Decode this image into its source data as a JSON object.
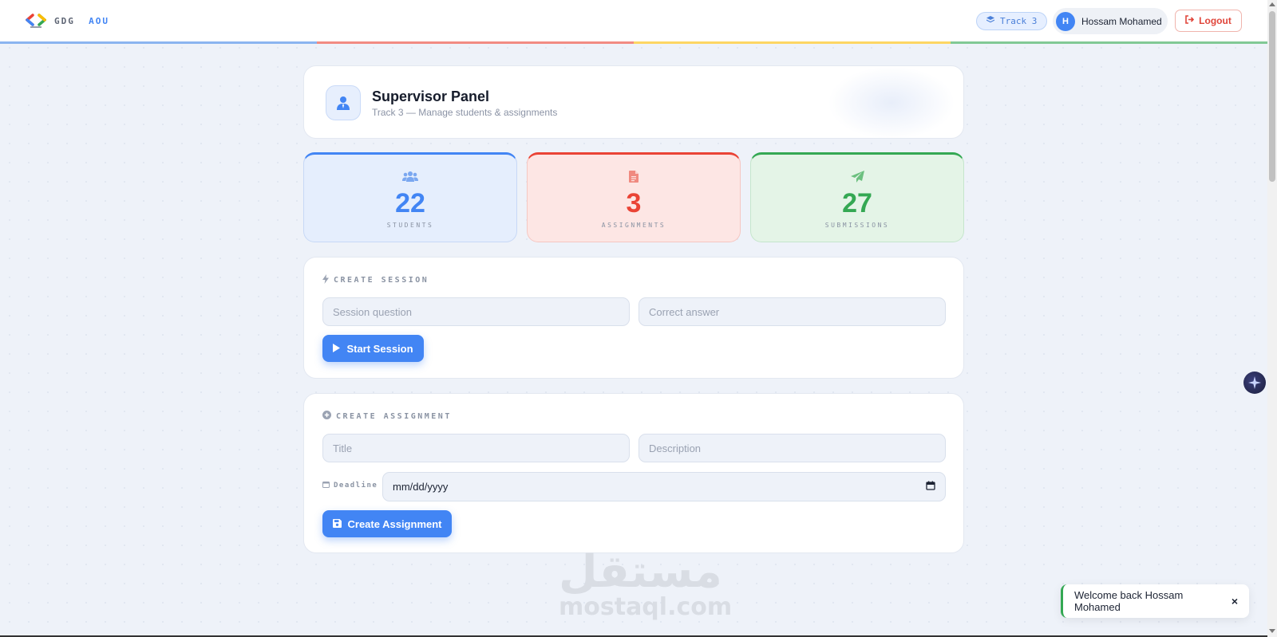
{
  "header": {
    "logo": {
      "word1": "GDG",
      "word2": "AOU"
    },
    "track_pill": "Track 3",
    "user": {
      "initial": "H",
      "name": "Hossam Mohamed"
    },
    "logout_label": "Logout",
    "color_bar": [
      "#8ab4f0",
      "#f28b82",
      "#fdd663",
      "#81c995"
    ]
  },
  "panel": {
    "title": "Supervisor Panel",
    "subtitle": "Track 3 — Manage students & assignments",
    "icon": "user-tie-icon"
  },
  "stats": [
    {
      "value": "22",
      "label": "STUDENTS",
      "icon": "users-icon",
      "color": "#4285f4"
    },
    {
      "value": "3",
      "label": "ASSIGNMENTS",
      "icon": "file-icon",
      "color": "#ea4335"
    },
    {
      "value": "27",
      "label": "SUBMISSIONS",
      "icon": "paper-plane-icon",
      "color": "#34a853"
    }
  ],
  "session": {
    "title": "CREATE SESSION",
    "question_placeholder": "Session question",
    "answer_placeholder": "Correct answer",
    "start_label": "Start Session"
  },
  "assignment": {
    "title": "CREATE ASSIGNMENT",
    "title_placeholder": "Title",
    "description_placeholder": "Description",
    "deadline_label": "Deadline",
    "date_placeholder": "mm/dd/yyyy",
    "create_label": "Create Assignment"
  },
  "watermark": {
    "arabic": "مستقل",
    "latin": "mostaql.com"
  },
  "toast": {
    "message": "Welcome back Hossam Mohamed",
    "close": "×"
  }
}
